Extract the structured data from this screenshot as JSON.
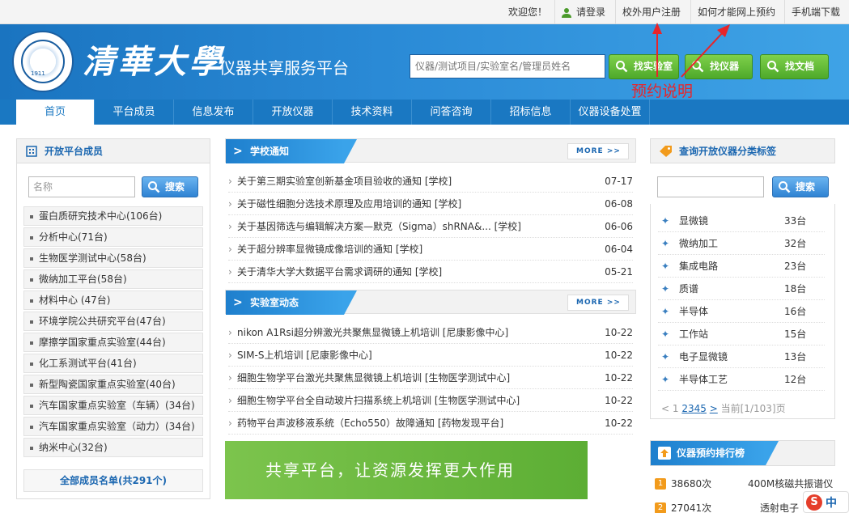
{
  "topbar": {
    "welcome": "欢迎您！",
    "login": "请登录",
    "register": "校外用户注册",
    "howto": "如何才能网上预约",
    "mobile": "手机端下载"
  },
  "header": {
    "logo_text": "清華大學",
    "seal_year": "1911",
    "platform_title": "仪器共享服务平台",
    "search_placeholder": "仪器/测试项目/实验室名/管理员姓名",
    "btn_lab": "找实验室",
    "btn_instrument": "找仪器",
    "btn_document": "找文档"
  },
  "nav": [
    "首页",
    "平台成员",
    "信息发布",
    "开放仪器",
    "技术资料",
    "问答咨询",
    "招标信息",
    "仪器设备处置"
  ],
  "left": {
    "title": "开放平台成员",
    "search_placeholder": "名称",
    "search_btn": "搜索",
    "members": [
      "蛋白质研究技术中心(106台)",
      "分析中心(71台)",
      "生物医学测试中心(58台)",
      "微纳加工平台(58台)",
      "材料中心 (47台)",
      "环境学院公共研究平台(47台)",
      "摩擦学国家重点实验室(44台)",
      "化工系测试平台(41台)",
      "新型陶瓷国家重点实验室(40台)",
      "汽车国家重点实验室（车辆）(34台)",
      "汽车国家重点实验室（动力）(34台)",
      "纳米中心(32台)"
    ],
    "all_members": "全部成员名单(共291个)"
  },
  "school_notice": {
    "title": "学校通知",
    "more": "MORE",
    "items": [
      {
        "title": "关于第三期实验室创新基金项目验收的通知 [学校]",
        "date": "07-17"
      },
      {
        "title": "关于磁性细胞分选技术原理及应用培训的通知 [学校]",
        "date": "06-08"
      },
      {
        "title": "关于基因筛选与编辑解决方案—默克（Sigma）shRNA&... [学校]",
        "date": "06-06"
      },
      {
        "title": "关于超分辨率显微镜成像培训的通知 [学校]",
        "date": "06-04"
      },
      {
        "title": "关于清华大学大数据平台需求调研的通知 [学校]",
        "date": "05-21"
      }
    ]
  },
  "lab_news": {
    "title": "实验室动态",
    "more": "MORE",
    "items": [
      {
        "title": "nikon A1Rsi超分辨激光共聚焦显微镜上机培训 [尼康影像中心]",
        "date": "10-22"
      },
      {
        "title": "SIM-S上机培训 [尼康影像中心]",
        "date": "10-22"
      },
      {
        "title": "细胞生物学平台激光共聚焦显微镜上机培训 [生物医学测试中心]",
        "date": "10-22"
      },
      {
        "title": "细胞生物学平台全自动玻片扫描系统上机培训 [生物医学测试中心]",
        "date": "10-22"
      },
      {
        "title": "药物平台声波移液系统（Echo550）故障通知 [药物发现平台]",
        "date": "10-22"
      }
    ]
  },
  "banner": "共享平台，让资源发挥更大作用",
  "right": {
    "title": "查询开放仪器分类标签",
    "search_btn": "搜索",
    "categories": [
      {
        "name": "显微镜",
        "count": "33台"
      },
      {
        "name": "微纳加工",
        "count": "32台"
      },
      {
        "name": "集成电路",
        "count": "23台"
      },
      {
        "name": "质谱",
        "count": "18台"
      },
      {
        "name": "半导体",
        "count": "16台"
      },
      {
        "name": "工作站",
        "count": "15台"
      },
      {
        "name": "电子显微镜",
        "count": "13台"
      },
      {
        "name": "半导体工艺",
        "count": "12台"
      }
    ],
    "pager": {
      "prev": "< 1",
      "pages": [
        "2",
        "3",
        "4",
        "5"
      ],
      "next": ">",
      "current": "当前[1/103]页"
    },
    "rank_title": "仪器预约排行榜",
    "ranks": [
      {
        "num": "1",
        "count": "38680次",
        "name": "400M核磁共振谱仪"
      },
      {
        "num": "2",
        "count": "27041次",
        "name": "透射电子"
      }
    ]
  },
  "annotation": {
    "text": "预约说明",
    "color": "#e8252a"
  },
  "ime": {
    "s": "S",
    "lang": "中"
  }
}
